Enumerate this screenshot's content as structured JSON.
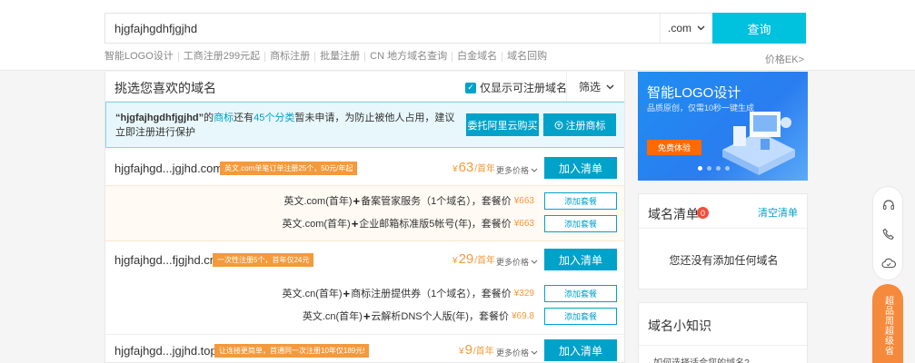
{
  "search": {
    "value": "hjgfajhgdhfjgjhd",
    "tld": ".com",
    "button": "查询"
  },
  "quick_links": [
    "智能LOGO设计",
    "工商注册299元起",
    "商标注册",
    "批量注册",
    "CN 地方域名查询",
    "白金域名",
    "域名回购"
  ],
  "price_link": "价格EK>",
  "main": {
    "title": "挑选您喜欢的域名",
    "only_registrable": "仅显示可注册域名",
    "filter": "筛选",
    "notice": {
      "quoted": "“hjgfajhgdhfjgjhd”",
      "t1": "的",
      "link1": "商标",
      "t2": "还有",
      "link2": "45个分类",
      "t3": "暂未申请，为防止被他人占用，建议立即注册进行保护",
      "btn_entrust": "委托阿里云购买",
      "btn_register": "注册商标"
    }
  },
  "rows": [
    {
      "domain": "hjgfajhgd...jgjhd.com",
      "promo": "英文.com单笔订单注册25个，50元/年起",
      "price_prefix": "¥",
      "price": "63",
      "price_unit": "/首年",
      "more": "更多价格",
      "add": "加入清单",
      "packages": [
        {
          "left": "英文.com(首年)",
          "right": "备案管家服务（1个域名），套餐价",
          "price": "¥663",
          "btn": "添加套餐"
        },
        {
          "left": "英文.com(首年)",
          "right": "企业邮箱标准版5帐号(年)，套餐价",
          "price": "¥663",
          "btn": "添加套餐"
        }
      ]
    },
    {
      "domain": "hjgfajhgd...fjgjhd.cn",
      "promo": "一次性注册5个，首年仅24元",
      "price_prefix": "¥",
      "price": "29",
      "price_unit": "/首年",
      "more": "更多价格",
      "add": "加入清单",
      "packages": [
        {
          "left": "英文.cn(首年)",
          "right": "商标注册提供券（1个域名），套餐价",
          "price": "¥329",
          "btn": "添加套餐"
        },
        {
          "left": "英文.cn(首年)",
          "right": "云解析DNS个人版(年)，套餐价",
          "price": "¥69.8",
          "btn": "添加套餐"
        }
      ]
    },
    {
      "domain": "hjgfajhgd...jgjhd.top",
      "promo": "让连接更简单，首通同一次注册10年仅189元!",
      "price_prefix": "¥",
      "price": "9",
      "price_unit": "/首年",
      "more": "更多价格",
      "add": "加入清单"
    }
  ],
  "banner": {
    "title": "智能LOGO设计",
    "subtitle": "品质原创，仅需10秒一键生成",
    "button": "免费体验"
  },
  "cart": {
    "title": "域名清单",
    "count": "0",
    "clear": "清空清单",
    "empty": "您还没有添加任何域名"
  },
  "knowledge": {
    "title": "域名小知识",
    "first_q": "· 如何选择适合您的域名?"
  },
  "side_promo": "超品周超级省",
  "colors": {
    "accent": "#00c1de",
    "primary": "#00a2ca",
    "price": "#f39a3d",
    "badge": "#f14e3a"
  }
}
